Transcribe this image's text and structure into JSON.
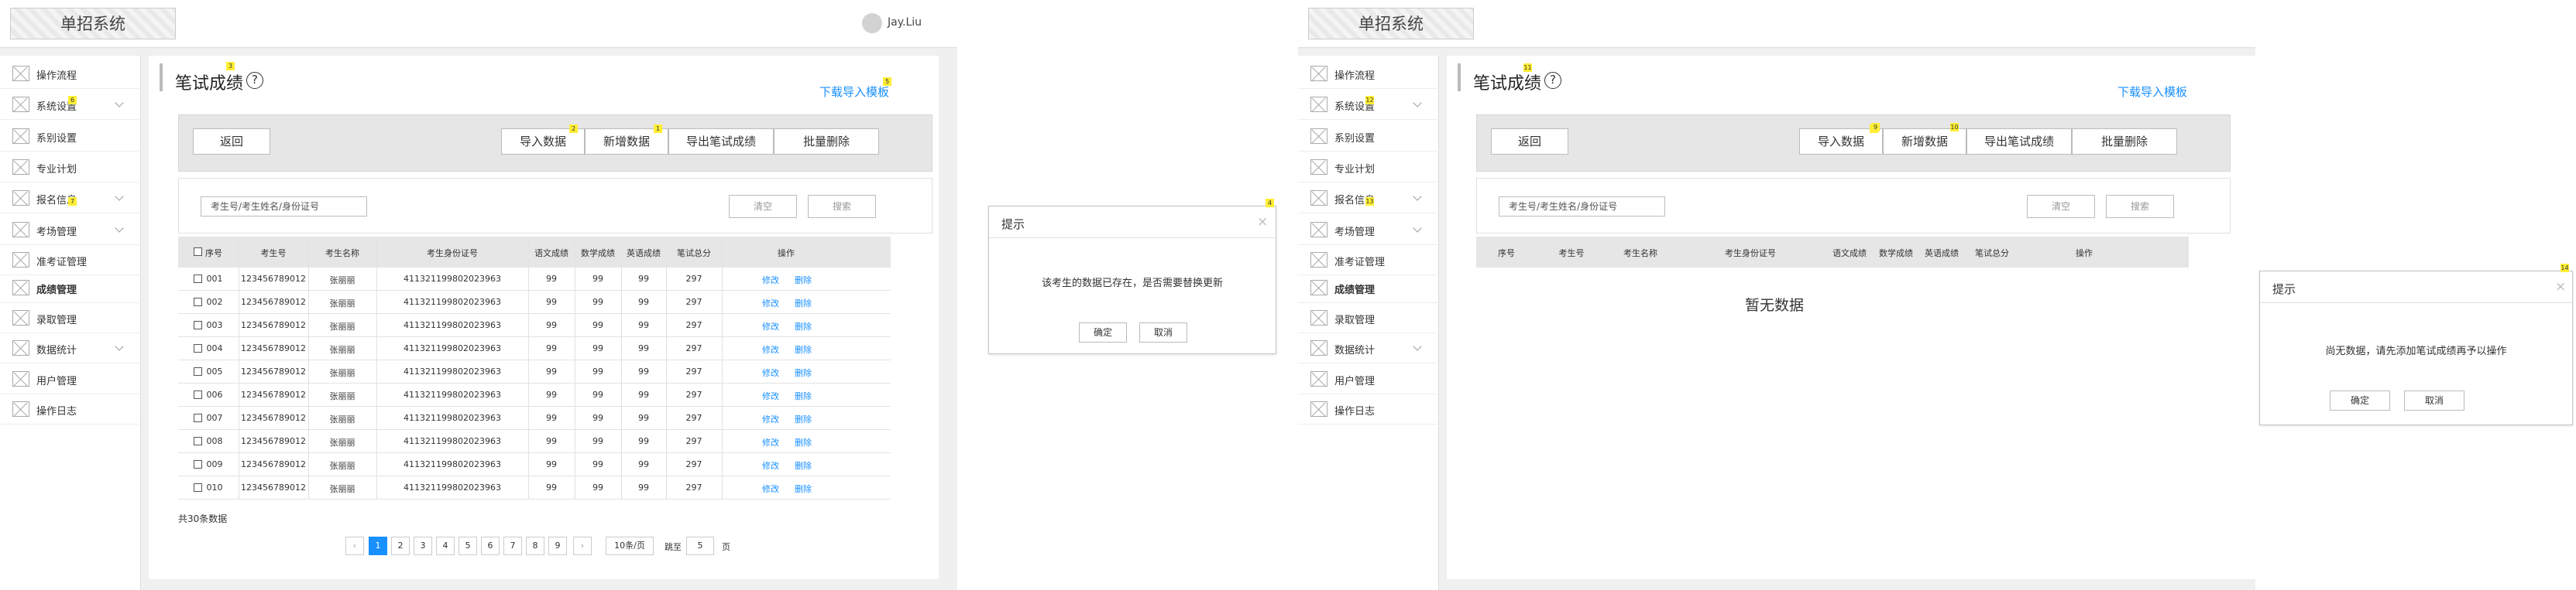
{
  "app": {
    "title": "单招系统",
    "username": "Jay.Liu"
  },
  "nav": [
    {
      "label": "操作流程",
      "bold": false,
      "chevron": false
    },
    {
      "label": "系统设置",
      "bold": false,
      "chevron": true
    },
    {
      "label": "系别设置",
      "bold": false,
      "chevron": false
    },
    {
      "label": "专业计划",
      "bold": false,
      "chevron": false
    },
    {
      "label": "报名信息",
      "bold": false,
      "chevron": true
    },
    {
      "label": "考场管理",
      "bold": false,
      "chevron": true
    },
    {
      "label": "准考证管理",
      "bold": false,
      "chevron": false
    },
    {
      "label": "成绩管理",
      "bold": true,
      "chevron": false
    },
    {
      "label": "录取管理",
      "bold": false,
      "chevron": false
    },
    {
      "label": "数据统计",
      "bold": false,
      "chevron": true
    },
    {
      "label": "用户管理",
      "bold": false,
      "chevron": false
    },
    {
      "label": "操作日志",
      "bold": false,
      "chevron": false
    }
  ],
  "page": {
    "title": "笔试成绩",
    "help": "?",
    "download_link": "下载导入模板",
    "back_button": "返回",
    "import_button": "导入数据",
    "add_button": "新增数据",
    "export_button": "导出笔试成绩",
    "batch_delete_button": "批量删除",
    "search_placeholder": "考生号/考生姓名/身份证号",
    "clear_button": "清空",
    "search_button": "搜索"
  },
  "table": {
    "headers": [
      "序号",
      "考生号",
      "考生名称",
      "考生身份证号",
      "语文成绩",
      "数学成绩",
      "英语成绩",
      "笔试总分",
      "操作"
    ],
    "edit_label": "修改",
    "delete_label": "删除",
    "rows": [
      {
        "seq": "001",
        "exam_no": "123456789012",
        "name": "张丽丽",
        "id_no": "411321199802023963",
        "chinese": "99",
        "math": "99",
        "english": "99",
        "total": "297"
      },
      {
        "seq": "002",
        "exam_no": "123456789012",
        "name": "张丽丽",
        "id_no": "411321199802023963",
        "chinese": "99",
        "math": "99",
        "english": "99",
        "total": "297"
      },
      {
        "seq": "003",
        "exam_no": "123456789012",
        "name": "张丽丽",
        "id_no": "411321199802023963",
        "chinese": "99",
        "math": "99",
        "english": "99",
        "total": "297"
      },
      {
        "seq": "004",
        "exam_no": "123456789012",
        "name": "张丽丽",
        "id_no": "411321199802023963",
        "chinese": "99",
        "math": "99",
        "english": "99",
        "total": "297"
      },
      {
        "seq": "005",
        "exam_no": "123456789012",
        "name": "张丽丽",
        "id_no": "411321199802023963",
        "chinese": "99",
        "math": "99",
        "english": "99",
        "total": "297"
      },
      {
        "seq": "006",
        "exam_no": "123456789012",
        "name": "张丽丽",
        "id_no": "411321199802023963",
        "chinese": "99",
        "math": "99",
        "english": "99",
        "total": "297"
      },
      {
        "seq": "007",
        "exam_no": "123456789012",
        "name": "张丽丽",
        "id_no": "411321199802023963",
        "chinese": "99",
        "math": "99",
        "english": "99",
        "total": "297"
      },
      {
        "seq": "008",
        "exam_no": "123456789012",
        "name": "张丽丽",
        "id_no": "411321199802023963",
        "chinese": "99",
        "math": "99",
        "english": "99",
        "total": "297"
      },
      {
        "seq": "009",
        "exam_no": "123456789012",
        "name": "张丽丽",
        "id_no": "411321199802023963",
        "chinese": "99",
        "math": "99",
        "english": "99",
        "total": "297"
      },
      {
        "seq": "010",
        "exam_no": "123456789012",
        "name": "张丽丽",
        "id_no": "411321199802023963",
        "chinese": "99",
        "math": "99",
        "english": "99",
        "total": "297"
      }
    ],
    "total_text": "共30条数据",
    "empty_text": "暂无数据"
  },
  "pagination": {
    "prev": "‹",
    "next": "›",
    "pages": [
      "1",
      "2",
      "3",
      "4",
      "5",
      "6",
      "7",
      "8",
      "9"
    ],
    "current": "1",
    "page_size": "10条/页",
    "jump_label": "跳至",
    "jump_value": "5",
    "page_unit": "页"
  },
  "dialogs": {
    "replace": {
      "title": "提示",
      "message": "该考生的数据已存在，是否需要替换更新",
      "confirm": "确定",
      "cancel": "取消"
    },
    "nodata": {
      "title": "提示",
      "message": "尚无数据，请先添加笔试成绩再予以操作",
      "confirm": "确定",
      "cancel": "取消"
    }
  },
  "markers": [
    "1",
    "2",
    "3",
    "4",
    "5",
    "6",
    "7",
    "8",
    "9",
    "10",
    "11",
    "12",
    "13",
    "14"
  ],
  "colors": {
    "link": "#1890ff",
    "marker": "#ffee33",
    "panel": "#e6e6e6",
    "background": "#f0f0f0"
  }
}
